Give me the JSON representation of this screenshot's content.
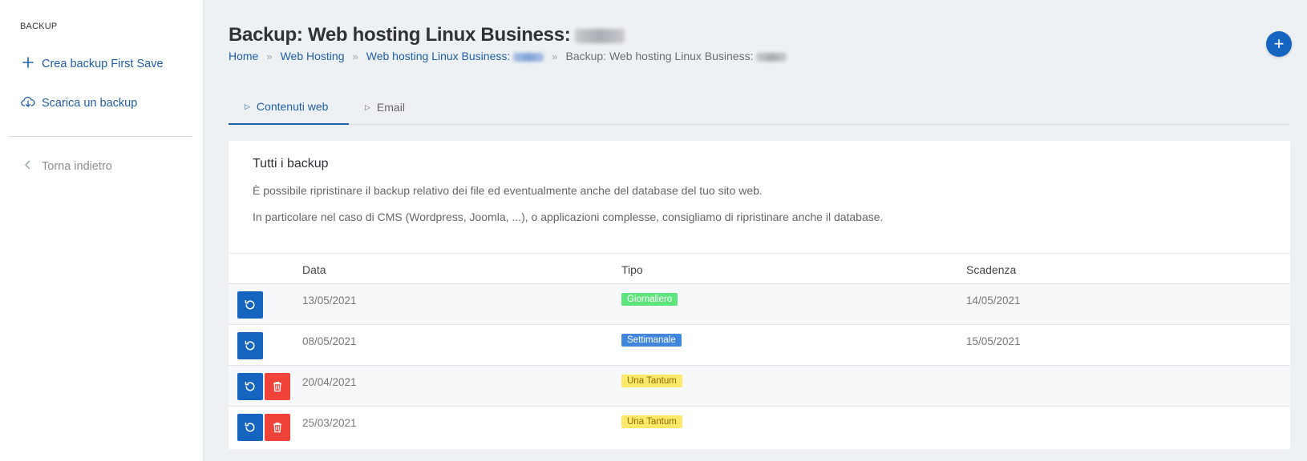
{
  "sidebar": {
    "section_title": "BACKUP",
    "items": [
      {
        "label": "Crea backup First Save",
        "icon": "plus-icon"
      },
      {
        "label": "Scarica un backup",
        "icon": "cloud-download-icon"
      }
    ],
    "back_label": "Torna indietro"
  },
  "header": {
    "title": "Backup: Web hosting Linux Business:",
    "breadcrumb": [
      {
        "label": "Home"
      },
      {
        "label": "Web Hosting"
      },
      {
        "label": "Web hosting Linux Business:"
      },
      {
        "label": "Backup: Web hosting Linux Business:"
      }
    ],
    "separator": "»",
    "add_button_label": "+"
  },
  "tabs": [
    {
      "label": "Contenuti web",
      "active": true
    },
    {
      "label": "Email",
      "active": false
    }
  ],
  "card": {
    "title": "Tutti i backup",
    "paragraph1": "È possibile ripristinare il backup relativo dei file ed eventualmente anche del database del tuo sito web.",
    "paragraph2": "In particolare nel caso di CMS (Wordpress, Joomla, ...), o applicazioni complesse, consigliamo di ripristinare anche il database."
  },
  "table": {
    "columns": [
      "Data",
      "Tipo",
      "Scadenza"
    ],
    "rows": [
      {
        "data": "13/05/2021",
        "tipo": "Giornaliero",
        "scadenza": "14/05/2021",
        "deletable": false
      },
      {
        "data": "08/05/2021",
        "tipo": "Settimanale",
        "scadenza": "15/05/2021",
        "deletable": false
      },
      {
        "data": "20/04/2021",
        "tipo": "Una Tantum",
        "scadenza": "",
        "deletable": true
      },
      {
        "data": "25/03/2021",
        "tipo": "Una Tantum",
        "scadenza": "",
        "deletable": true
      }
    ]
  },
  "colors": {
    "primary": "#1565c0",
    "danger": "#f0433a",
    "badge_giornaliero": "#5ee37d",
    "badge_settimanale": "#3f86dc",
    "badge_una_tantum": "#ffe96b"
  }
}
